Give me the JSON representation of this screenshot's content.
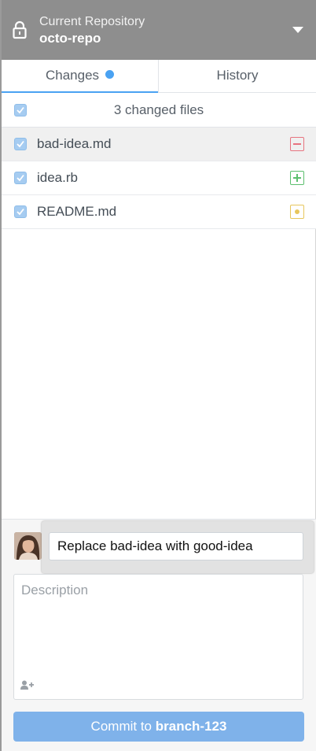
{
  "header": {
    "label": "Current Repository",
    "repo_name": "octo-repo",
    "icon": "lock-icon",
    "dropdown_icon": "chevron-down-icon"
  },
  "tabs": [
    {
      "label": "Changes",
      "active": true,
      "has_indicator": true
    },
    {
      "label": "History",
      "active": false
    }
  ],
  "changes": {
    "count_label": "3 changed files",
    "files": [
      {
        "name": "bad-idea.md",
        "status": "deleted",
        "checked": true,
        "selected": true
      },
      {
        "name": "idea.rb",
        "status": "added",
        "checked": true,
        "selected": false
      },
      {
        "name": "README.md",
        "status": "modified",
        "checked": true,
        "selected": false
      }
    ]
  },
  "commit": {
    "summary_value": "Replace bad-idea with good-idea",
    "description_placeholder": "Description",
    "button_prefix": "Commit to ",
    "branch": "branch-123"
  },
  "colors": {
    "header_bg": "#8e8e8e",
    "accent": "#4aa2f2",
    "deleted": "#e77480",
    "added": "#5cbf6e",
    "modified": "#e7c65c",
    "commit_button": "#7fb2ea"
  }
}
